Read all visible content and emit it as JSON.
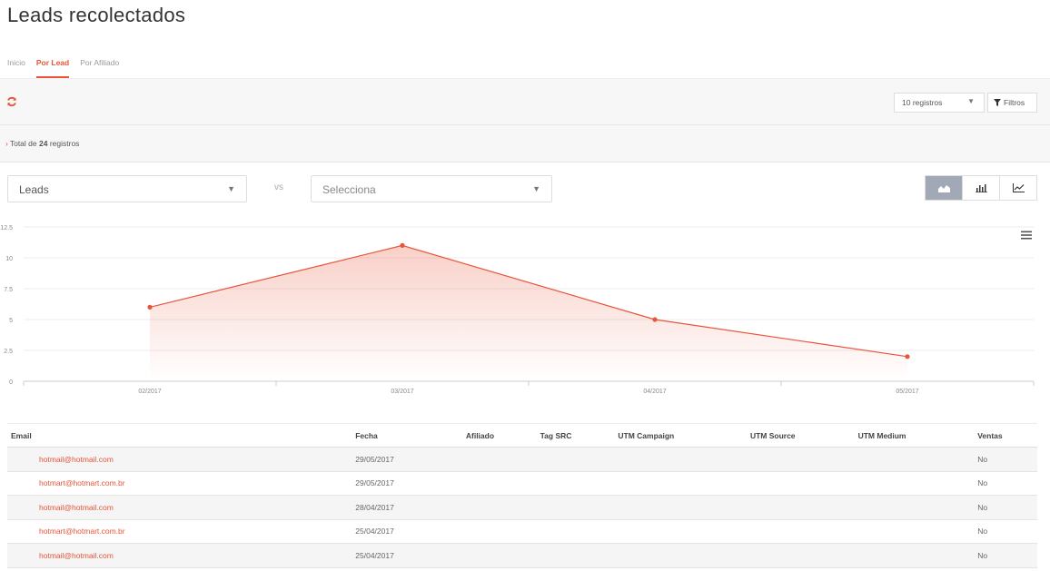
{
  "page": {
    "title": "Leads recolectados"
  },
  "tabs": [
    {
      "label": "Inicio"
    },
    {
      "label": "Por Lead"
    },
    {
      "label": "Por Afiliado"
    }
  ],
  "toolbar": {
    "records_select": "10 registros",
    "filters_label": "Filtros"
  },
  "summary": {
    "prefix": "Total de",
    "count": "24",
    "suffix": "registros"
  },
  "compare": {
    "left_select": "Leads",
    "vs_label": "vs",
    "right_placeholder": "Selecciona"
  },
  "chart_types": [
    {
      "name": "area-chart-icon",
      "active": true
    },
    {
      "name": "bar-chart-icon",
      "active": false
    },
    {
      "name": "line-chart-icon",
      "active": false
    }
  ],
  "colors": {
    "accent": "#e8553a",
    "active_toggle": "#a0a9b5"
  },
  "chart_data": {
    "type": "area",
    "categories": [
      "02/2017",
      "03/2017",
      "04/2017",
      "05/2017"
    ],
    "series": [
      {
        "values": [
          6,
          11,
          5,
          2
        ]
      }
    ],
    "yticks": [
      "0",
      "2.5",
      "5",
      "7.5",
      "10",
      "12.5"
    ],
    "ylim": [
      0,
      12.5
    ],
    "grid": true
  },
  "table": {
    "headers": [
      "Email",
      "Fecha",
      "Afiliado",
      "Tag SRC",
      "UTM Campaign",
      "UTM Source",
      "UTM Medium",
      "Ventas"
    ],
    "rows": [
      {
        "email": "hotmail@hotmail.com",
        "fecha": "29/05/2017",
        "ventas": "No"
      },
      {
        "email": "hotmart@hotmart.com.br",
        "fecha": "29/05/2017",
        "ventas": "No"
      },
      {
        "email": "hotmail@hotmail.com",
        "fecha": "28/04/2017",
        "ventas": "No"
      },
      {
        "email": "hotmart@hotmart.com.br",
        "fecha": "25/04/2017",
        "ventas": "No"
      },
      {
        "email": "hotmail@hotmail.com",
        "fecha": "25/04/2017",
        "ventas": "No"
      }
    ]
  }
}
